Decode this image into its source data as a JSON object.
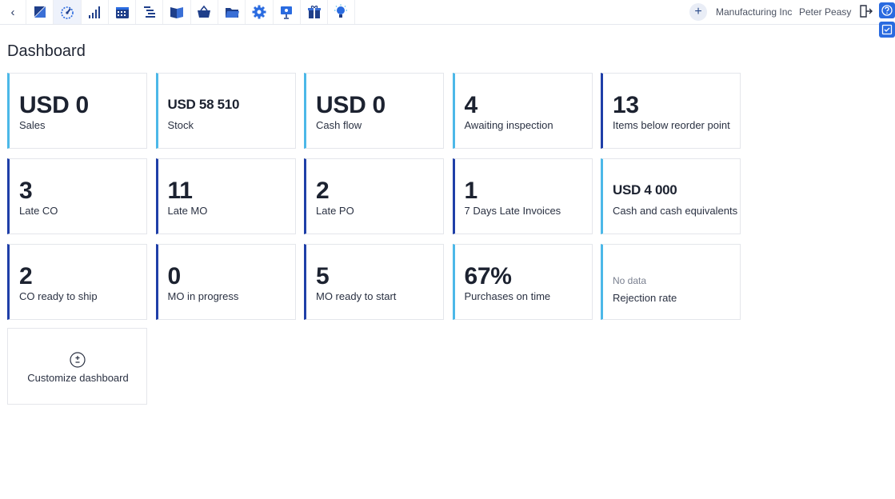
{
  "topbar": {
    "back_glyph": "‹",
    "nav_icons": [
      {
        "name": "sales-icon",
        "color": "#1f3f8a"
      },
      {
        "name": "dashboard-gauge-icon",
        "color": "#2a6be0"
      },
      {
        "name": "stats-bars-icon",
        "color": "#1f3f8a"
      },
      {
        "name": "calendar-icon",
        "color": "#1f3f8a"
      },
      {
        "name": "planning-list-icon",
        "color": "#1f3f8a"
      },
      {
        "name": "book-icon",
        "color": "#1f3f8a"
      },
      {
        "name": "basket-icon",
        "color": "#1f3f8a"
      },
      {
        "name": "folder-icon",
        "color": "#1f3f8a"
      },
      {
        "name": "settings-gear-icon",
        "color": "#2a6be0"
      },
      {
        "name": "presentation-icon",
        "color": "#2a6be0"
      },
      {
        "name": "gift-icon",
        "color": "#1f3f8a"
      },
      {
        "name": "lightbulb-icon",
        "color": "#2a6be0"
      }
    ],
    "plus_label": "+",
    "company": "Manufacturing Inc",
    "user": "Peter Peasy"
  },
  "page": {
    "title": "Dashboard"
  },
  "cards": [
    {
      "value": "USD 0",
      "label": "Sales"
    },
    {
      "value": "USD 58 510",
      "label": "Stock"
    },
    {
      "value": "USD 0",
      "label": "Cash flow"
    },
    {
      "value": "4",
      "label": "Awaiting inspection"
    },
    {
      "value": "13",
      "label": "Items below reorder point"
    },
    {
      "value": "3",
      "label": "Late CO"
    },
    {
      "value": "11",
      "label": "Late MO"
    },
    {
      "value": "2",
      "label": "Late PO"
    },
    {
      "value": "1",
      "label": "7 Days Late Invoices"
    },
    {
      "value": "USD 4 000",
      "label": "Cash and cash equivalents"
    },
    {
      "value": "2",
      "label": "CO ready to ship"
    },
    {
      "value": "0",
      "label": "MO in progress"
    },
    {
      "value": "5",
      "label": "MO ready to start"
    },
    {
      "value": "67%",
      "label": "Purchases on time"
    },
    {
      "value": "No data",
      "label": "Rejection rate"
    }
  ],
  "customize": {
    "label": "Customize dashboard"
  },
  "colors": {
    "accent_dark": "#1f3fa8",
    "accent_light": "#4cb8e8",
    "side_button": "#2a6be0"
  }
}
